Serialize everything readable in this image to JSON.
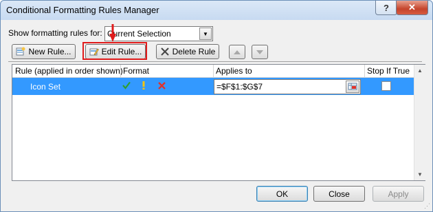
{
  "window": {
    "title": "Conditional Formatting Rules Manager",
    "help_label": "?",
    "close_label": "✕"
  },
  "show_for": {
    "label": "Show formatting rules for:",
    "selected": "Current Selection"
  },
  "toolbar": {
    "new_label": "New Rule...",
    "edit_label": "Edit Rule...",
    "delete_label": "Delete Rule"
  },
  "grid": {
    "columns": [
      "Rule (applied in order shown)",
      "Format",
      "Applies to",
      "Stop If True"
    ],
    "rows": [
      {
        "rule": "Icon Set",
        "format_icons": [
          "green-check-icon",
          "yellow-exclamation-icon",
          "red-x-icon"
        ],
        "applies_to": "=$F$1:$G$7",
        "stop_if_true": false
      }
    ]
  },
  "footer": {
    "ok_label": "OK",
    "close_label": "Close",
    "apply_label": "Apply"
  },
  "annotation": {
    "highlight_color": "#e01b1b"
  }
}
